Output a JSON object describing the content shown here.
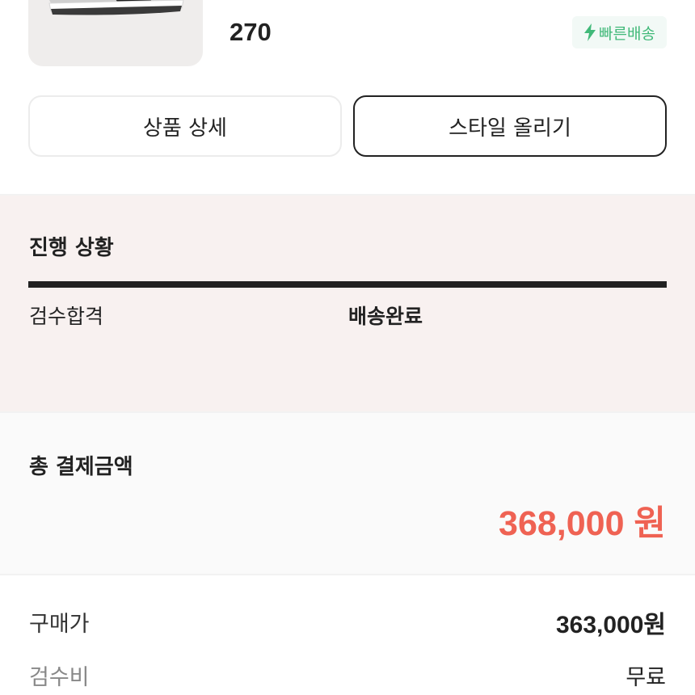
{
  "product": {
    "image_icon": "sneaker-image",
    "size": "270",
    "badge": {
      "icon": "lightning-icon",
      "label": "빠른배송",
      "color": "#41b979"
    }
  },
  "actions": {
    "detail_label": "상품 상세",
    "style_label": "스타일 올리기"
  },
  "progress": {
    "title": "진행 상황",
    "steps": [
      "검수합격",
      "배송완료"
    ],
    "progress_fraction": 1.0
  },
  "total": {
    "title": "총 결제금액",
    "amount": "368,000 원",
    "color": "#ef6253"
  },
  "breakdown": [
    {
      "label": "구매가",
      "value": "363,000원"
    },
    {
      "label": "검수비",
      "value": "무료"
    }
  ]
}
